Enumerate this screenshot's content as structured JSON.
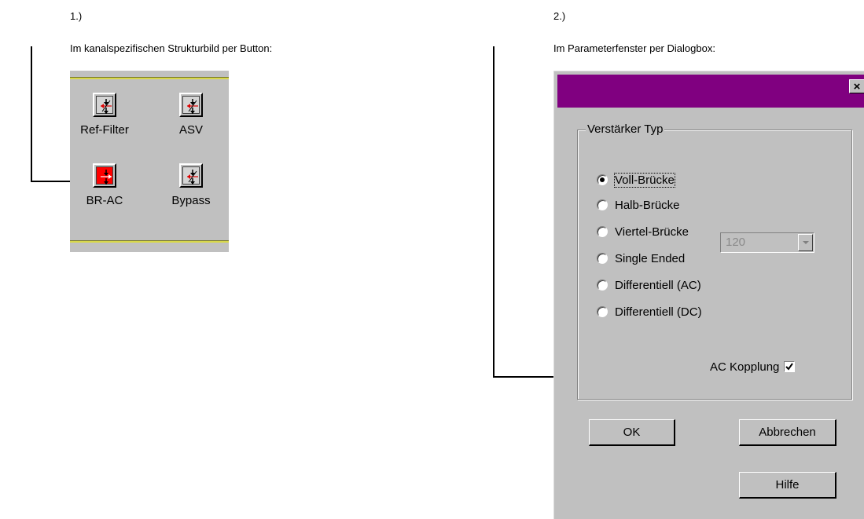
{
  "panel1": {
    "number": "1.)",
    "heading": "Im kanalspezifischen Strukturbild per Button:",
    "buttons": [
      {
        "label": "Ref-Filter",
        "icon": "filter-icon",
        "active": false
      },
      {
        "label": "ASV",
        "icon": "filter-icon",
        "active": false
      },
      {
        "label": "BR-AC",
        "icon": "bridge-ac-icon",
        "active": true
      },
      {
        "label": "Bypass",
        "icon": "filter-icon",
        "active": false
      }
    ]
  },
  "panel2": {
    "number": "2.)",
    "heading": "Im Parameterfenster per Dialogbox:",
    "dialog": {
      "close_label": "×",
      "group_title": "Verstärker Typ",
      "options": [
        {
          "label": "Voll-Brücke",
          "selected": true
        },
        {
          "label": "Halb-Brücke",
          "selected": false
        },
        {
          "label": "Viertel-Brücke",
          "selected": false
        },
        {
          "label": "Single Ended",
          "selected": false
        },
        {
          "label": "Differentiell (AC)",
          "selected": false
        },
        {
          "label": "Differentiell (DC)",
          "selected": false
        }
      ],
      "resistance_value": "120",
      "ac_coupling_label": "AC Kopplung",
      "ac_coupling_checked": true,
      "ok_label": "OK",
      "cancel_label": "Abbrechen",
      "help_label": "Hilfe"
    }
  },
  "colors": {
    "dialog_title_bar": "#800080",
    "active_button": "#ff0000",
    "window_face": "#c0c0c0",
    "toolbar_stripe": "#d8d84a"
  }
}
